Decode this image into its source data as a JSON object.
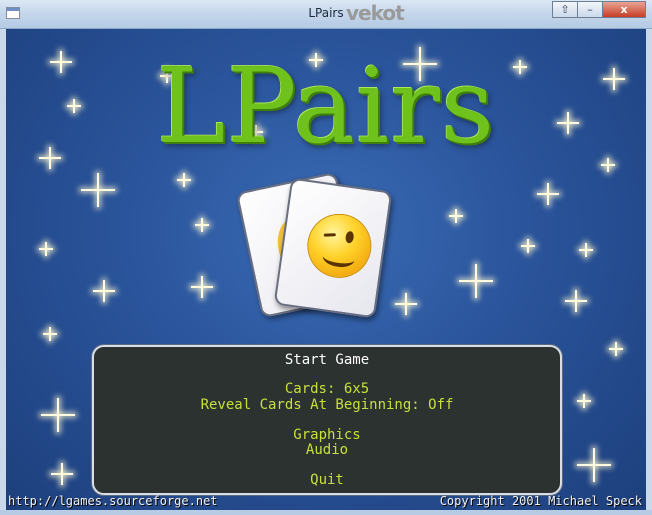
{
  "window": {
    "title": "LPairs",
    "brand": {
      "main": "vekot",
      "dots": [
        "•",
        "•",
        "•"
      ]
    },
    "buttons": {
      "minimize": "–",
      "maximize": "⇧",
      "close": "x"
    }
  },
  "game": {
    "logo": "LPairs",
    "menu": {
      "items": [
        {
          "label": "Start Game"
        },
        {
          "label": "Cards: 6x5"
        },
        {
          "label": "Reveal Cards At Beginning: Off"
        },
        {
          "label": "Graphics"
        },
        {
          "label": "Audio"
        },
        {
          "label": "Quit"
        }
      ]
    },
    "footer": {
      "website": "http://lgames.sourceforge.net",
      "copyright": "Copyright 2001 Michael Speck"
    }
  },
  "icons": {
    "card_front": "winking-smiley-card-icon",
    "card_back": "smiley-card-icon",
    "stars": "sparkle-star-icon"
  },
  "colors": {
    "background": "#2a549b",
    "logo": "#6fc21c",
    "menu_bg": "#2b322f",
    "menu_text": "#e8e8b0",
    "menu_value": "#c8e03a"
  }
}
